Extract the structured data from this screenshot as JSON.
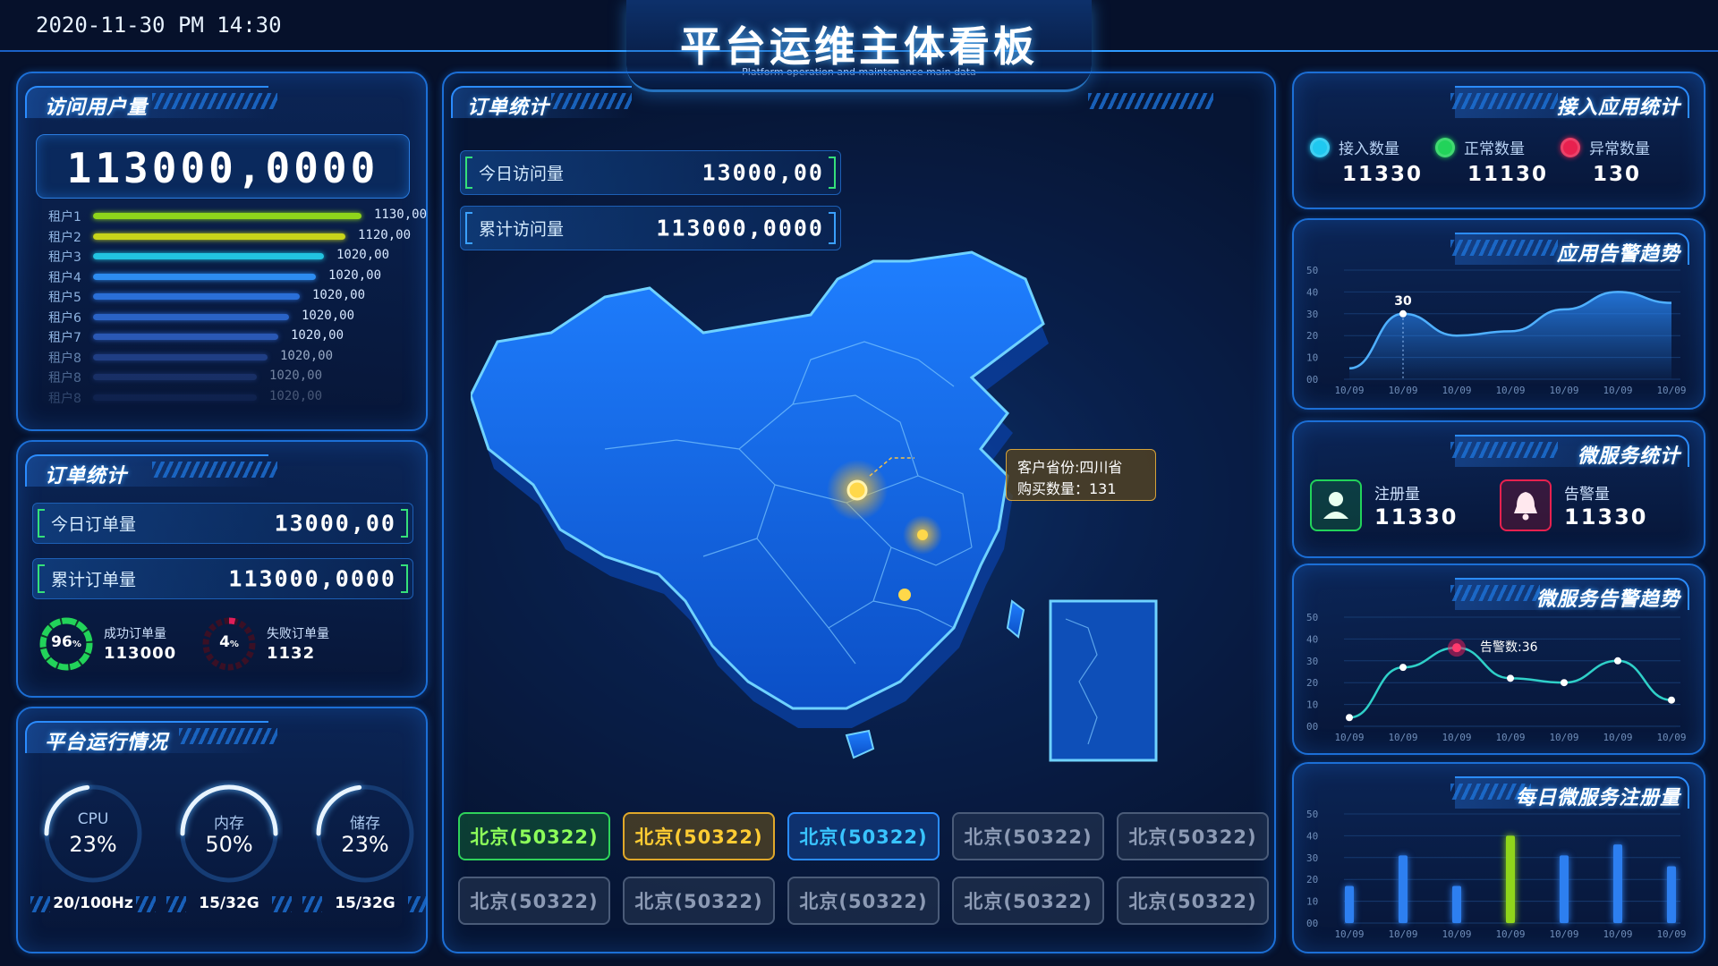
{
  "header": {
    "datetime": "2020-11-30  PM 14:30",
    "title": "平台运维主体看板",
    "subtitle": "Platform operation and maintenance main data"
  },
  "visits": {
    "title": "访问用户量",
    "total": "113000,0000",
    "tenants": [
      {
        "label": "租户1",
        "value": "1130,00",
        "fill": 1.0,
        "color": "#8fd51b"
      },
      {
        "label": "租户2",
        "value": "1120,00",
        "fill": 0.94,
        "color": "#c8d41a"
      },
      {
        "label": "租户3",
        "value": "1020,00",
        "fill": 0.86,
        "color": "#22c3e0"
      },
      {
        "label": "租户4",
        "value": "1020,00",
        "fill": 0.83,
        "color": "#2d8cf0"
      },
      {
        "label": "租户5",
        "value": "1020,00",
        "fill": 0.77,
        "color": "#2a6fd8"
      },
      {
        "label": "租户6",
        "value": "1020,00",
        "fill": 0.73,
        "color": "#2a63c6"
      },
      {
        "label": "租户7",
        "value": "1020,00",
        "fill": 0.69,
        "color": "#2a58b4"
      },
      {
        "label": "租户8",
        "value": "1020,00",
        "fill": 0.65,
        "color": "#2a4fa2"
      },
      {
        "label": "租户8",
        "value": "1020,00",
        "fill": 0.61,
        "color": "#2a4790"
      },
      {
        "label": "租户8",
        "value": "1020,00",
        "fill": 0.61,
        "color": "#233e7e"
      }
    ]
  },
  "orders": {
    "title": "订单统计",
    "today_label": "今日订单量",
    "today_value": "13000,00",
    "total_label": "累计订单量",
    "total_value": "113000,0000",
    "success": {
      "pct": "96",
      "unit": "%",
      "label": "成功订单量",
      "value": "113000",
      "fraction": 0.96,
      "color": "#22d35a"
    },
    "fail": {
      "pct": "4",
      "unit": "%",
      "label": "失败订单量",
      "value": "1132",
      "fraction": 0.04,
      "color": "#e01e5a"
    }
  },
  "platform": {
    "title": "平台运行情况",
    "gauges": [
      {
        "name": "CPU",
        "value": "23%",
        "sub": "20/100Hz",
        "fraction": 0.23
      },
      {
        "name": "内存",
        "value": "50%",
        "sub": "15/32G",
        "fraction": 0.5
      },
      {
        "name": "储存",
        "value": "23%",
        "sub": "15/32G",
        "fraction": 0.23
      }
    ]
  },
  "center": {
    "title": "订单统计",
    "today_label": "今日访问量",
    "today_value": "13000,00",
    "total_label": "累计访问量",
    "total_value": "113000,0000",
    "tooltip_line1": "客户省份:四川省",
    "tooltip_line2": "购买数量：131",
    "tags": [
      {
        "text": "北京(50322)",
        "style": "green"
      },
      {
        "text": "北京(50322)",
        "style": "yellow"
      },
      {
        "text": "北京(50322)",
        "style": "blue"
      },
      {
        "text": "北京(50322)",
        "style": "gray"
      },
      {
        "text": "北京(50322)",
        "style": "gray"
      },
      {
        "text": "北京(50322)",
        "style": "gray"
      },
      {
        "text": "北京(50322)",
        "style": "gray"
      },
      {
        "text": "北京(50322)",
        "style": "gray"
      },
      {
        "text": "北京(50322)",
        "style": "gray"
      },
      {
        "text": "北京(50322)",
        "style": "gray"
      }
    ]
  },
  "apps": {
    "title": "接入应用统计",
    "items": [
      {
        "label": "接入数量",
        "value": "11330",
        "color": "#1fc8f0"
      },
      {
        "label": "正常数量",
        "value": "11130",
        "color": "#22d35a"
      },
      {
        "label": "异常数量",
        "value": "130",
        "color": "#e8214f"
      }
    ]
  },
  "alert_trend": {
    "title": "应用告警趋势",
    "marker": "30"
  },
  "micro": {
    "title": "微服务统计",
    "reg_label": "注册量",
    "reg_value": "11330",
    "alarm_label": "告警量",
    "alarm_value": "11330"
  },
  "micro_trend": {
    "title": "微服务告警趋势",
    "annotation": "告警数:36"
  },
  "daily": {
    "title": "每日微服务注册量"
  },
  "chart_data": [
    {
      "type": "area",
      "title": "应用告警趋势",
      "x": [
        "10/09",
        "10/09",
        "10/09",
        "10/09",
        "10/09",
        "10/09",
        "10/09"
      ],
      "y_ticks": [
        "00",
        "10",
        "20",
        "30",
        "40",
        "50"
      ],
      "ylim": [
        0,
        50
      ],
      "values": [
        5,
        30,
        20,
        22,
        32,
        40,
        35
      ],
      "highlight": {
        "index": 1,
        "label": "30"
      }
    },
    {
      "type": "line",
      "title": "微服务告警趋势",
      "x": [
        "10/09",
        "10/09",
        "10/09",
        "10/09",
        "10/09",
        "10/09",
        "10/09"
      ],
      "y_ticks": [
        "00",
        "10",
        "20",
        "30",
        "40",
        "50"
      ],
      "ylim": [
        0,
        50
      ],
      "values": [
        4,
        27,
        36,
        22,
        20,
        30,
        12
      ],
      "highlight": {
        "index": 2,
        "label": "告警数:36"
      }
    },
    {
      "type": "bar",
      "title": "每日微服务注册量",
      "categories": [
        "10/09",
        "10/09",
        "10/09",
        "10/09",
        "10/09",
        "10/09",
        "10/09"
      ],
      "y_ticks": [
        "00",
        "10",
        "20",
        "30",
        "40",
        "50"
      ],
      "ylim": [
        0,
        50
      ],
      "values": [
        17,
        31,
        17,
        40,
        31,
        36,
        26
      ],
      "highlight_index": 3
    }
  ]
}
